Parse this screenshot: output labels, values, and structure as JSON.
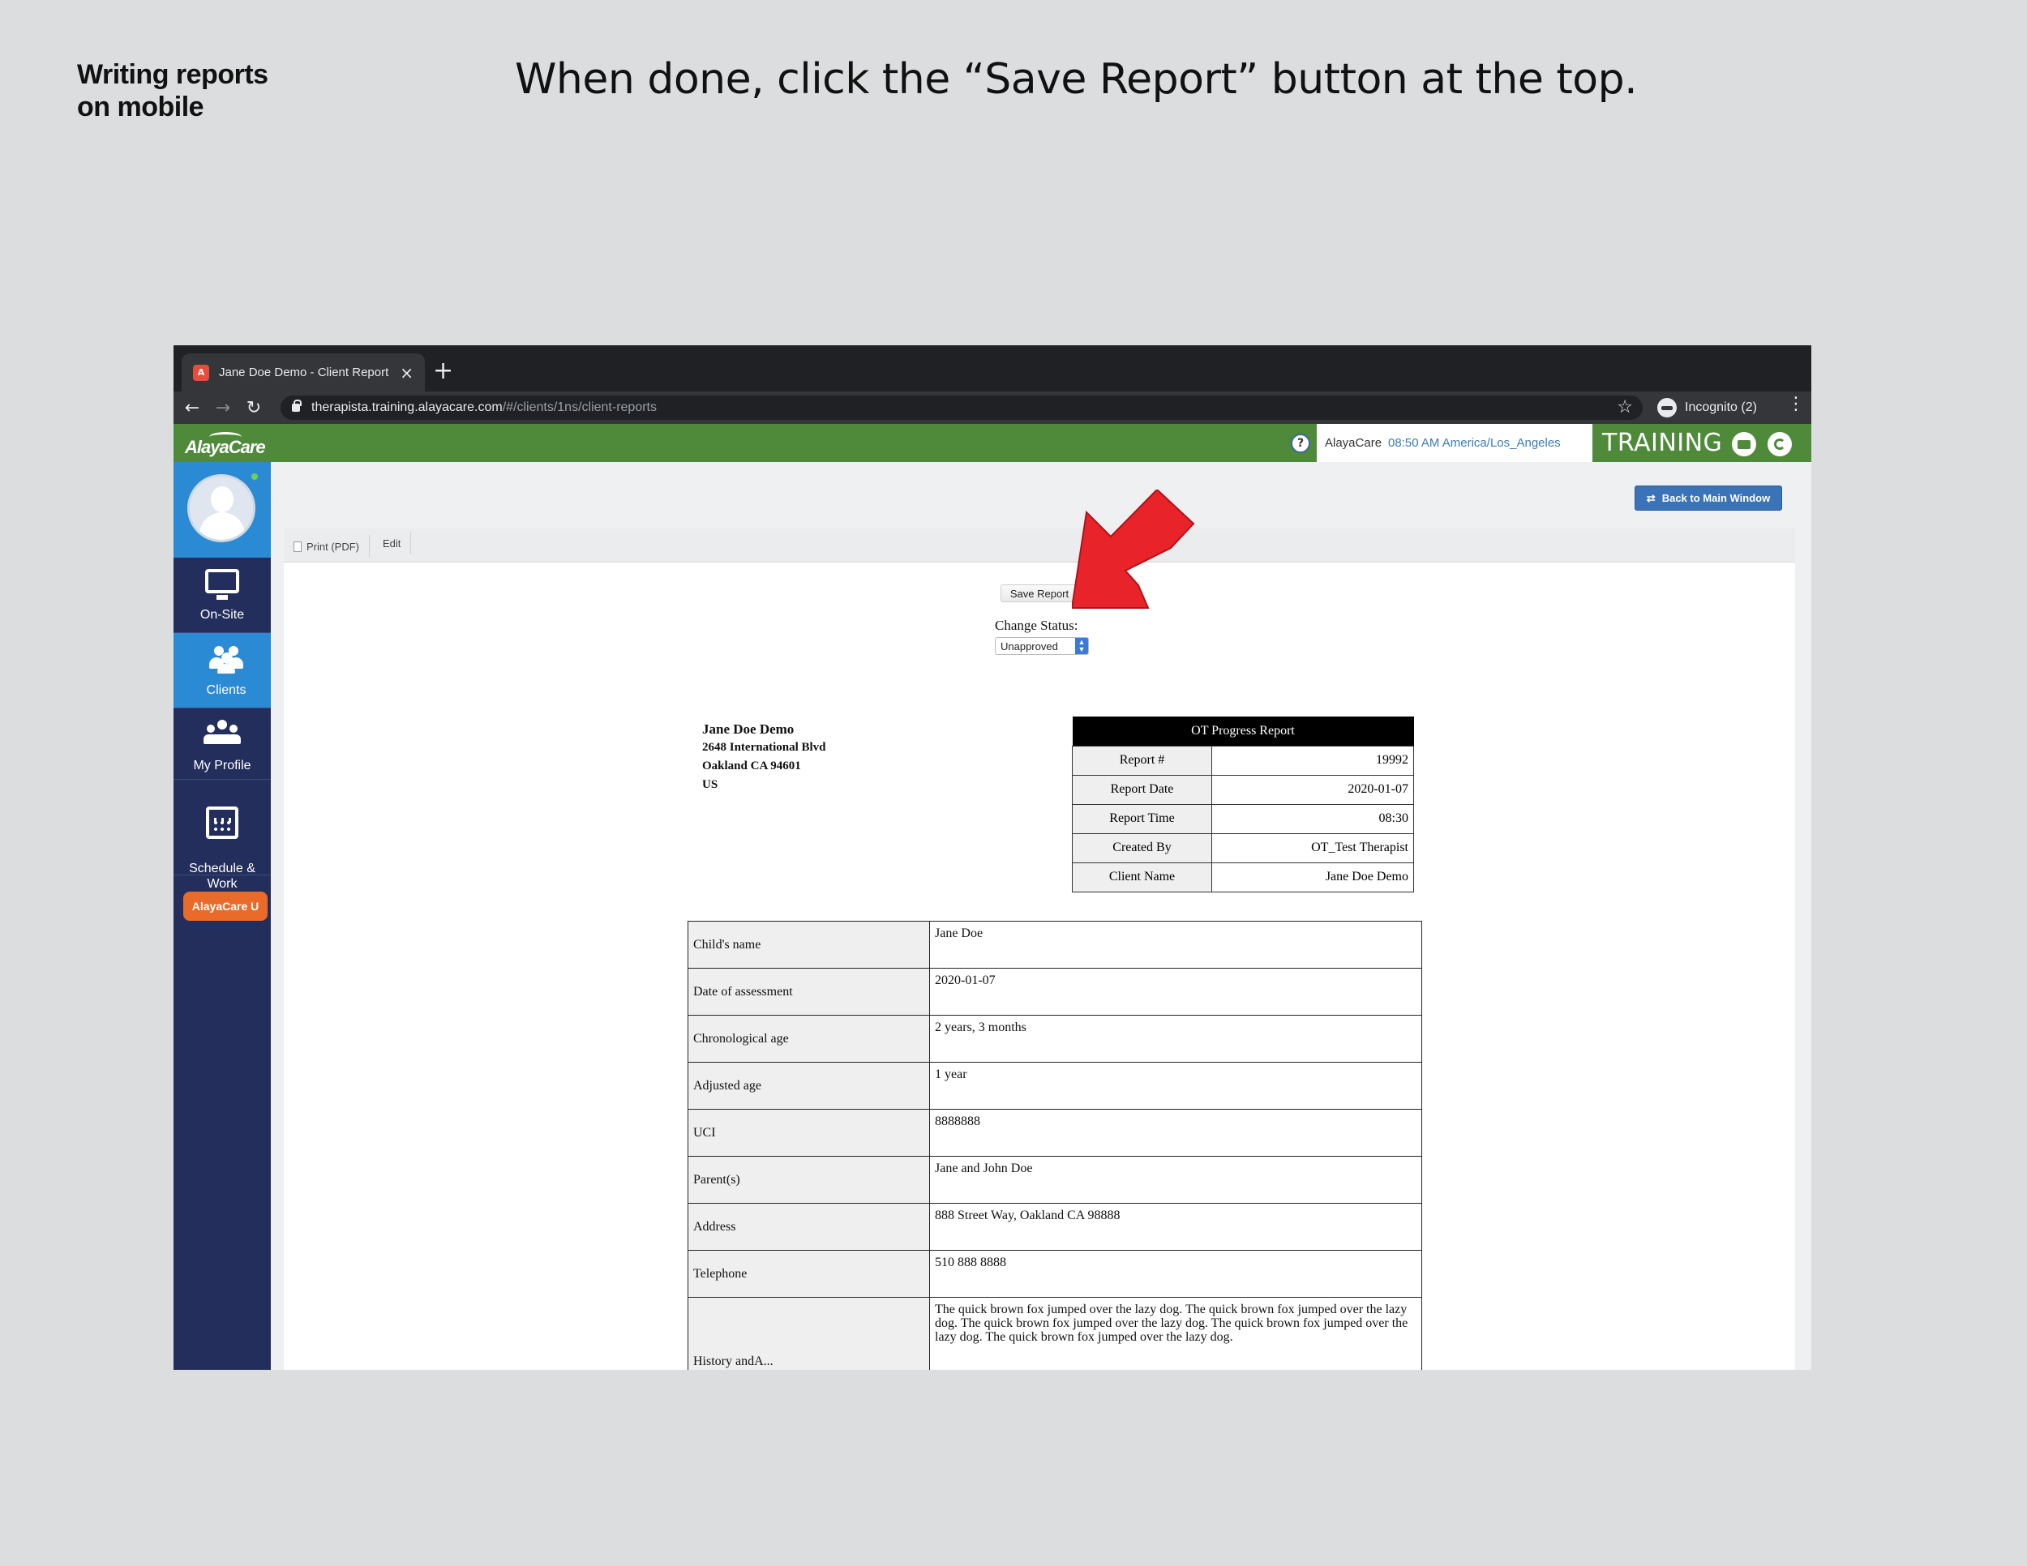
{
  "slide": {
    "label": "Writing reports\non mobile",
    "title": "When done, click the “Save Report” button at the top."
  },
  "browser": {
    "tab_title": "Jane Doe Demo - Client Report",
    "url_host": "therapista.training.alayacare.com",
    "url_path": "/#/clients/1ns/client-reports",
    "incognito": "Incognito (2)"
  },
  "appbar": {
    "logo": "AlayaCare",
    "clock_brand": "AlayaCare",
    "clock_time": "08:50 AM America/Los_Angeles",
    "training": "TRAINING"
  },
  "sidebar": {
    "items": [
      {
        "label": "On-Site"
      },
      {
        "label": "Clients"
      },
      {
        "label": "My Profile"
      },
      {
        "label": "Schedule &\nWork"
      }
    ],
    "alayacare_u": "AlayaCare U"
  },
  "toolbar": {
    "back": "Back to Main Window",
    "print": "Print (PDF)",
    "edit": "Edit"
  },
  "report": {
    "save_label": "Save Report",
    "change_status_label": "Change Status:",
    "status_value": "Unapproved",
    "address": {
      "name": "Jane Doe Demo",
      "street": "2648 International Blvd",
      "city": "Oakland CA 94601",
      "country": "US"
    },
    "summary_title": "OT Progress Report",
    "summary": [
      {
        "k": "Report #",
        "v": "19992"
      },
      {
        "k": "Report Date",
        "v": "2020-01-07"
      },
      {
        "k": "Report Time",
        "v": "08:30"
      },
      {
        "k": "Created By",
        "v": "OT_Test Therapist"
      },
      {
        "k": "Client Name",
        "v": "Jane Doe Demo"
      }
    ],
    "details": [
      {
        "k": "Child's name",
        "v": "Jane Doe"
      },
      {
        "k": "Date of assessment",
        "v": "2020-01-07"
      },
      {
        "k": "Chronological age",
        "v": "2 years, 3 months"
      },
      {
        "k": "Adjusted age",
        "v": "1 year"
      },
      {
        "k": "UCI",
        "v": "8888888"
      },
      {
        "k": "Parent(s)",
        "v": "Jane and John Doe"
      },
      {
        "k": "Address",
        "v": "888 Street Way, Oakland CA 98888"
      },
      {
        "k": "Telephone",
        "v": "510 888 8888"
      },
      {
        "k": "History andA...",
        "v": "The quick brown fox jumped over the lazy dog. The quick brown fox jumped over the lazy dog. The quick brown fox jumped over the lazy dog. The quick brown fox jumped over the lazy dog. The quick brown fox jumped over the lazy dog."
      }
    ]
  },
  "colors": {
    "appbar": "#4e8a3a",
    "sidebar": "#242e5c",
    "sidebar_active": "#2a8ad4",
    "arrow": "#e8232a",
    "accent_button": "#3a73b8"
  }
}
